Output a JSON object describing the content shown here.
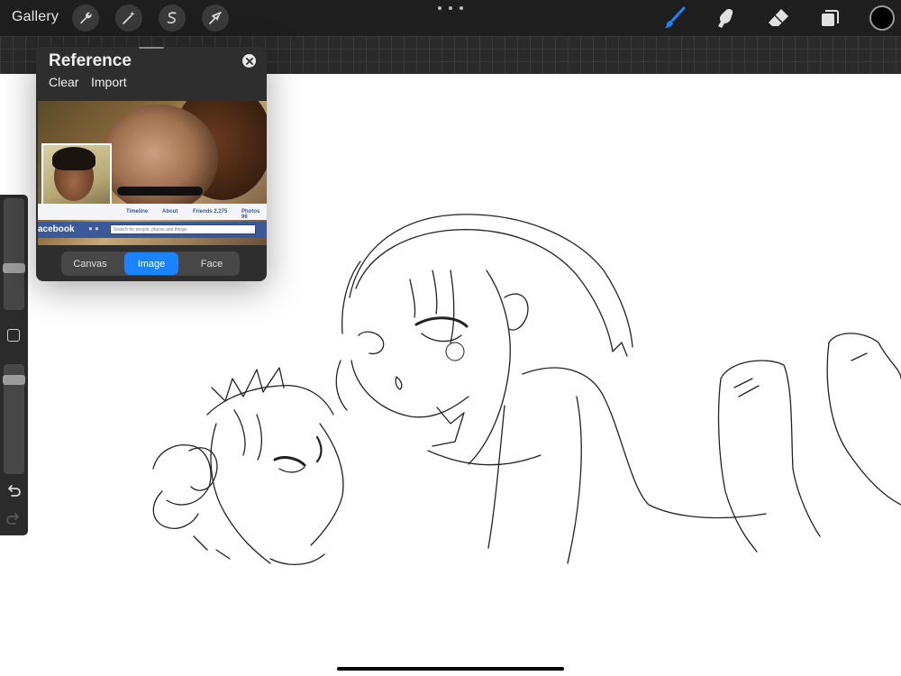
{
  "app": {
    "gallery_label": "Gallery"
  },
  "toolbar": {
    "left_tools": [
      {
        "name": "actions",
        "icon": "wrench-icon"
      },
      {
        "name": "adjustments",
        "icon": "magic-wand-icon"
      },
      {
        "name": "selection",
        "icon": "selection-s-icon"
      },
      {
        "name": "transform",
        "icon": "arrow-cursor-icon"
      }
    ],
    "right_tools": [
      {
        "name": "brush",
        "icon": "brush-icon",
        "active": true
      },
      {
        "name": "smudge",
        "icon": "smudge-finger-icon"
      },
      {
        "name": "eraser",
        "icon": "eraser-icon"
      },
      {
        "name": "layers",
        "icon": "layers-icon"
      }
    ],
    "active_color": "#000000",
    "accent_color": "#1a84ff"
  },
  "sidebar": {
    "brush_size_level": 0.4,
    "opacity_level": 0.1
  },
  "reference": {
    "title": "Reference",
    "clear_label": "Clear",
    "import_label": "Import",
    "image": {
      "fb_tabs": [
        "Timeline",
        "About",
        "Friends 2,275",
        "Photos 96"
      ],
      "fb_logo": "acebook",
      "fb_search_placeholder": "Search for people, places and things"
    },
    "modes": [
      {
        "label": "Canvas",
        "active": false
      },
      {
        "label": "Image",
        "active": true
      },
      {
        "label": "Face",
        "active": false
      }
    ]
  }
}
